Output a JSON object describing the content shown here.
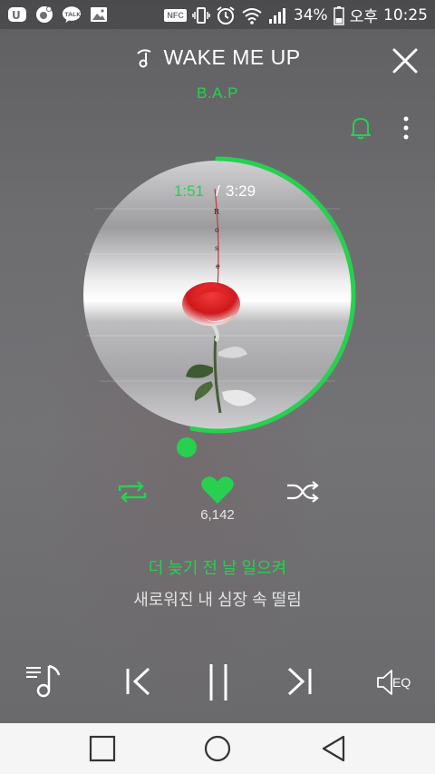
{
  "status_bar": {
    "nfc_label": "NFC",
    "battery": "34%",
    "ampm": "오후",
    "time": "10:25",
    "left_icons": [
      "u-plus-icon",
      "music-notification-icon",
      "kakaotalk-icon",
      "gallery-icon"
    ]
  },
  "header": {
    "title": "WAKE ME UP",
    "artist": "B.A.P"
  },
  "player": {
    "current_time": "1:51",
    "separator": "/",
    "total_time": "3:29",
    "progress": 0.53,
    "likes": "6,142"
  },
  "lyrics": {
    "current": "더 늦기 전 날 일으켜",
    "next": "새로워진 내 심장 속 떨림"
  },
  "controls": {
    "eq_label": "EQ"
  },
  "colors": {
    "accent": "#28d050",
    "background": "#6f6f71"
  }
}
